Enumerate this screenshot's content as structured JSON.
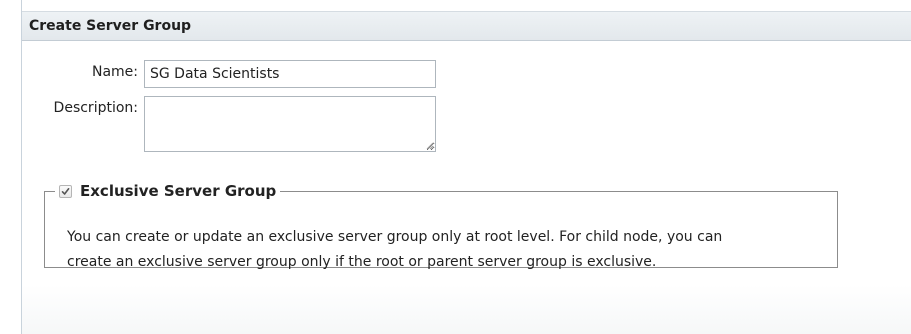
{
  "dialog": {
    "title": "Create Server Group"
  },
  "form": {
    "name_label": "Name:",
    "name_value": "SG Data Scientists",
    "description_label": "Description:",
    "description_value": ""
  },
  "exclusive_group": {
    "label": "Exclusive Server Group",
    "checked": true,
    "help_line1": "You can create or update an exclusive server group only at root level. For child node, you can",
    "help_line2": "create an exclusive server group only if the root or parent server group is exclusive."
  },
  "icons": {
    "checkbox": "check-icon",
    "resize": "resize-grip-icon"
  },
  "colors": {
    "titlebar": "#e3e8ec",
    "border": "#8c8c8c"
  }
}
